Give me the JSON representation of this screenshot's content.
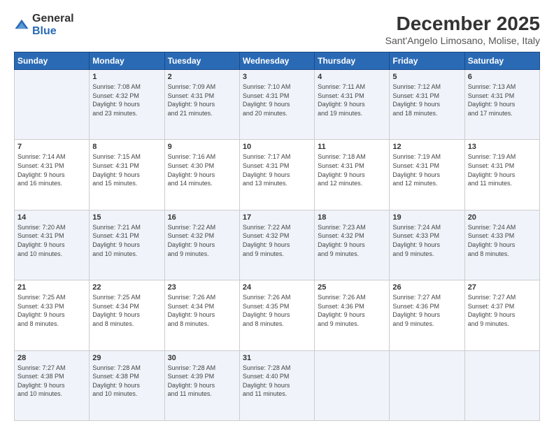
{
  "logo": {
    "general": "General",
    "blue": "Blue"
  },
  "title": "December 2025",
  "subtitle": "Sant'Angelo Limosano, Molise, Italy",
  "header_days": [
    "Sunday",
    "Monday",
    "Tuesday",
    "Wednesday",
    "Thursday",
    "Friday",
    "Saturday"
  ],
  "weeks": [
    [
      {
        "day": "",
        "info": ""
      },
      {
        "day": "1",
        "info": "Sunrise: 7:08 AM\nSunset: 4:32 PM\nDaylight: 9 hours\nand 23 minutes."
      },
      {
        "day": "2",
        "info": "Sunrise: 7:09 AM\nSunset: 4:31 PM\nDaylight: 9 hours\nand 21 minutes."
      },
      {
        "day": "3",
        "info": "Sunrise: 7:10 AM\nSunset: 4:31 PM\nDaylight: 9 hours\nand 20 minutes."
      },
      {
        "day": "4",
        "info": "Sunrise: 7:11 AM\nSunset: 4:31 PM\nDaylight: 9 hours\nand 19 minutes."
      },
      {
        "day": "5",
        "info": "Sunrise: 7:12 AM\nSunset: 4:31 PM\nDaylight: 9 hours\nand 18 minutes."
      },
      {
        "day": "6",
        "info": "Sunrise: 7:13 AM\nSunset: 4:31 PM\nDaylight: 9 hours\nand 17 minutes."
      }
    ],
    [
      {
        "day": "7",
        "info": "Sunrise: 7:14 AM\nSunset: 4:31 PM\nDaylight: 9 hours\nand 16 minutes."
      },
      {
        "day": "8",
        "info": "Sunrise: 7:15 AM\nSunset: 4:31 PM\nDaylight: 9 hours\nand 15 minutes."
      },
      {
        "day": "9",
        "info": "Sunrise: 7:16 AM\nSunset: 4:30 PM\nDaylight: 9 hours\nand 14 minutes."
      },
      {
        "day": "10",
        "info": "Sunrise: 7:17 AM\nSunset: 4:31 PM\nDaylight: 9 hours\nand 13 minutes."
      },
      {
        "day": "11",
        "info": "Sunrise: 7:18 AM\nSunset: 4:31 PM\nDaylight: 9 hours\nand 12 minutes."
      },
      {
        "day": "12",
        "info": "Sunrise: 7:19 AM\nSunset: 4:31 PM\nDaylight: 9 hours\nand 12 minutes."
      },
      {
        "day": "13",
        "info": "Sunrise: 7:19 AM\nSunset: 4:31 PM\nDaylight: 9 hours\nand 11 minutes."
      }
    ],
    [
      {
        "day": "14",
        "info": "Sunrise: 7:20 AM\nSunset: 4:31 PM\nDaylight: 9 hours\nand 10 minutes."
      },
      {
        "day": "15",
        "info": "Sunrise: 7:21 AM\nSunset: 4:31 PM\nDaylight: 9 hours\nand 10 minutes."
      },
      {
        "day": "16",
        "info": "Sunrise: 7:22 AM\nSunset: 4:32 PM\nDaylight: 9 hours\nand 9 minutes."
      },
      {
        "day": "17",
        "info": "Sunrise: 7:22 AM\nSunset: 4:32 PM\nDaylight: 9 hours\nand 9 minutes."
      },
      {
        "day": "18",
        "info": "Sunrise: 7:23 AM\nSunset: 4:32 PM\nDaylight: 9 hours\nand 9 minutes."
      },
      {
        "day": "19",
        "info": "Sunrise: 7:24 AM\nSunset: 4:33 PM\nDaylight: 9 hours\nand 9 minutes."
      },
      {
        "day": "20",
        "info": "Sunrise: 7:24 AM\nSunset: 4:33 PM\nDaylight: 9 hours\nand 8 minutes."
      }
    ],
    [
      {
        "day": "21",
        "info": "Sunrise: 7:25 AM\nSunset: 4:33 PM\nDaylight: 9 hours\nand 8 minutes."
      },
      {
        "day": "22",
        "info": "Sunrise: 7:25 AM\nSunset: 4:34 PM\nDaylight: 9 hours\nand 8 minutes."
      },
      {
        "day": "23",
        "info": "Sunrise: 7:26 AM\nSunset: 4:34 PM\nDaylight: 9 hours\nand 8 minutes."
      },
      {
        "day": "24",
        "info": "Sunrise: 7:26 AM\nSunset: 4:35 PM\nDaylight: 9 hours\nand 8 minutes."
      },
      {
        "day": "25",
        "info": "Sunrise: 7:26 AM\nSunset: 4:36 PM\nDaylight: 9 hours\nand 9 minutes."
      },
      {
        "day": "26",
        "info": "Sunrise: 7:27 AM\nSunset: 4:36 PM\nDaylight: 9 hours\nand 9 minutes."
      },
      {
        "day": "27",
        "info": "Sunrise: 7:27 AM\nSunset: 4:37 PM\nDaylight: 9 hours\nand 9 minutes."
      }
    ],
    [
      {
        "day": "28",
        "info": "Sunrise: 7:27 AM\nSunset: 4:38 PM\nDaylight: 9 hours\nand 10 minutes."
      },
      {
        "day": "29",
        "info": "Sunrise: 7:28 AM\nSunset: 4:38 PM\nDaylight: 9 hours\nand 10 minutes."
      },
      {
        "day": "30",
        "info": "Sunrise: 7:28 AM\nSunset: 4:39 PM\nDaylight: 9 hours\nand 11 minutes."
      },
      {
        "day": "31",
        "info": "Sunrise: 7:28 AM\nSunset: 4:40 PM\nDaylight: 9 hours\nand 11 minutes."
      },
      {
        "day": "",
        "info": ""
      },
      {
        "day": "",
        "info": ""
      },
      {
        "day": "",
        "info": ""
      }
    ]
  ]
}
